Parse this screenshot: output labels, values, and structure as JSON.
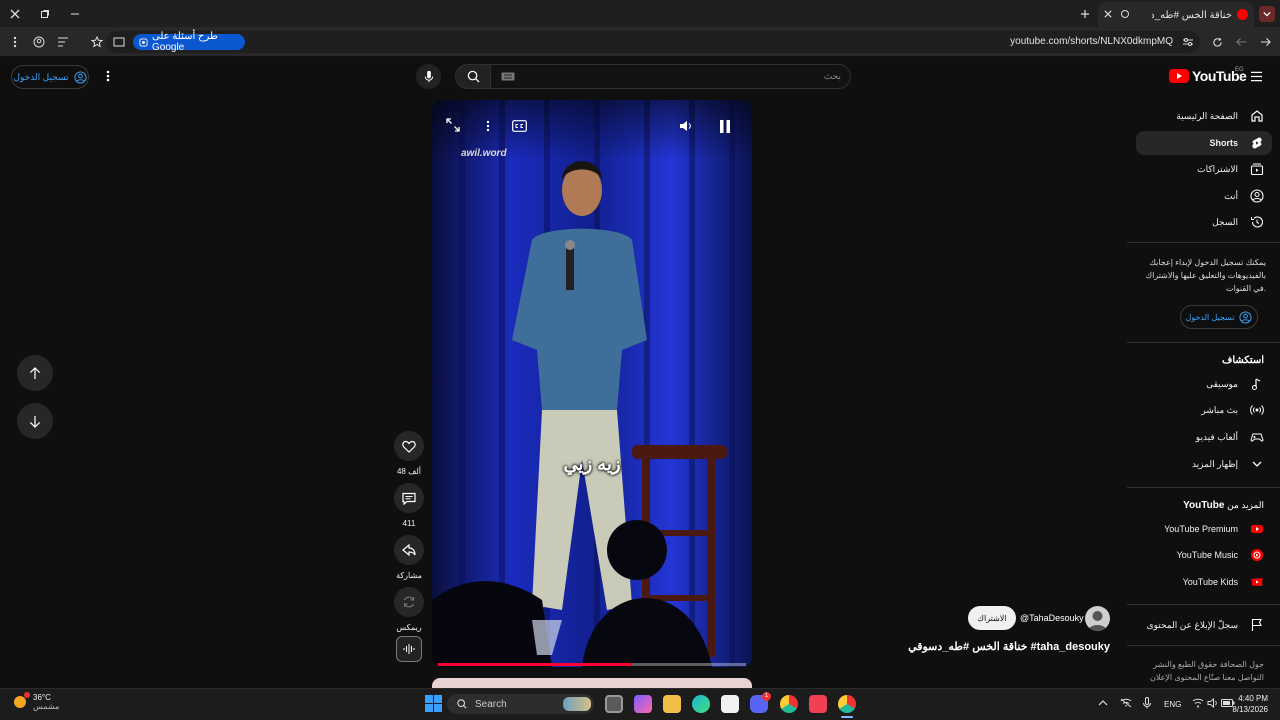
{
  "browser": {
    "tab_title": "خناقة الخس #طه_دسوقي #taha_desouky",
    "url": "youtube.com/shorts/NLNX0dkmpMQ",
    "google_pill": "طرح أسئلة على Google"
  },
  "header": {
    "signin": "تسجيل الدخول",
    "search_placeholder": "بحث",
    "logo": "YouTube",
    "country": "EG"
  },
  "sidebar": {
    "main_items": [
      {
        "label": "الصفحة الرئيسية",
        "icon": "home-icon"
      },
      {
        "label": "Shorts",
        "icon": "shorts-icon"
      },
      {
        "label": "الاشتراكات",
        "icon": "subscriptions-icon"
      },
      {
        "label": "أنت",
        "icon": "account-icon"
      },
      {
        "label": "السجل",
        "icon": "history-icon"
      }
    ],
    "signin_note": "يمكنك تسجيل الدخول لإبداء إعجابك بالفيديوهات والتعليق عليها والاشتراك في القنوات.",
    "signin": "تسجيل الدخول",
    "explore_title": "استكشاف",
    "explore_items": [
      {
        "label": "موسيقى",
        "icon": "music-icon"
      },
      {
        "label": "بث مباشر",
        "icon": "live-icon"
      },
      {
        "label": "ألعاب فيديو",
        "icon": "gaming-icon"
      },
      {
        "label": "إظهار المزيد",
        "icon": "chevron-down-icon"
      }
    ],
    "more_title": "المزيد من",
    "more_title_brand": "YouTube",
    "more_items": [
      {
        "label": "YouTube Premium",
        "icon": "yt-premium-icon"
      },
      {
        "label": "YouTube Music",
        "icon": "yt-music-icon"
      },
      {
        "label": "YouTube Kids",
        "icon": "yt-kids-icon"
      }
    ],
    "report": "سجلّ الإبلاغ عن المحتوى",
    "footer_line1": "حول  الصحافة  حقوق الطبع والنشر",
    "footer_line2": "التواصل معنا  صنّاع المحتوى  الإعلان"
  },
  "player": {
    "watermark": "awil.word",
    "subtitle": "زيه زيي",
    "progress": 0.63
  },
  "actions": {
    "likes": "48 ألف",
    "comments": "411",
    "share": "مشاركة",
    "remix": "ريمكس"
  },
  "video_info": {
    "channel": "@TahaDesouky",
    "subscribe": "الاشتراك",
    "title": "خناقة الخس #طه_دسوقي #taha_desouky"
  },
  "taskbar": {
    "weather_temp": "36°C",
    "weather_desc": "مشمس",
    "search": "Search",
    "lang": "ENG",
    "time": "4:40 PM",
    "date": "8/13/2026",
    "badge_count": "1"
  },
  "colors": {
    "accent_blue": "#3ea6ff",
    "yt_red": "#ff0000",
    "progress_red": "#ff0033",
    "curtain_blue": "#1b2bbd"
  }
}
